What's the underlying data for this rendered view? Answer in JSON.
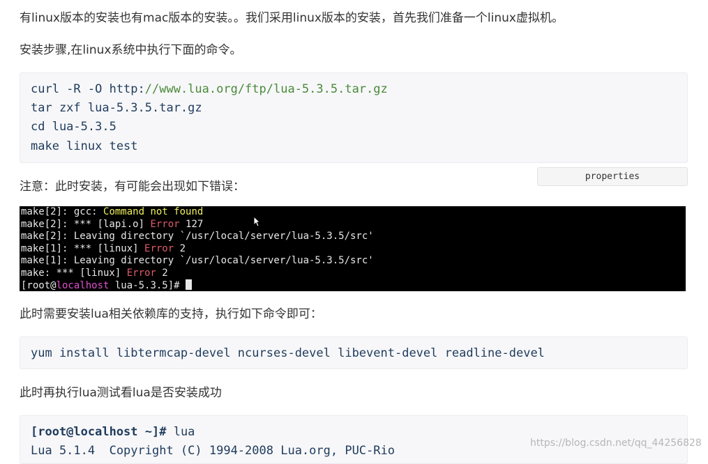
{
  "article": {
    "para_install_intro": "有linux版本的安装也有mac版本的安装。。我们采用linux版本的安装，首先我们准备一个linux虚拟机。",
    "para_steps": "安装步骤,在linux系统中执行下面的命令。",
    "build_commands": {
      "line1_prefix": "curl -R -O http:",
      "line1_url": "//www.lua.org/ftp/lua-5.3.5.tar.gz",
      "line2": "tar zxf lua-5.3.5.tar.gz",
      "line3": "cd lua-5.3.5",
      "line4": "make linux test"
    },
    "properties_label": "properties",
    "para_note": "注意：此时安装，有可能会出现如下错误：",
    "terminal": {
      "l1_a": "make[2]: gcc: ",
      "l1_b": "Command not found",
      "l2_a": "make[2]: *** [lapi.o] ",
      "l2_b": "Error",
      "l2_c": " 127",
      "l3": "make[2]: Leaving directory `/usr/local/server/lua-5.3.5/src'",
      "l4_a": "make[1]: *** [linux] ",
      "l4_b": "Error",
      "l4_c": " 2",
      "l5": "make[1]: Leaving directory `/usr/local/server/lua-5.3.5/src'",
      "l6_a": "make: *** [linux] ",
      "l6_b": "Error",
      "l6_c": " 2",
      "l7_a": "[root@",
      "l7_b": "localhost",
      "l7_c": " lua-5.3.5]# "
    },
    "para_deps": "此时需要安装lua相关依赖库的支持，执行如下命令即可：",
    "yum_command": "yum install libtermcap-devel ncurses-devel libevent-devel readline-devel",
    "para_test": "此时再执行lua测试看lua是否安装成功",
    "run_test": {
      "prompt": "[root@localhost ~]#",
      "cmd": " lua",
      "output": "Lua 5.1.4  Copyright (C) 1994-2008 Lua.org, PUC-Rio"
    },
    "watermark": "https://blog.csdn.net/qq_44256828"
  },
  "colors": {
    "code_bg": "#f7f7f9",
    "code_text": "#1f3b5c",
    "url_green": "#4a8a3a",
    "terminal_bg": "#000000",
    "terminal_yellow": "#f0f060",
    "terminal_red": "#e05a6a",
    "terminal_magenta": "#e050d0"
  }
}
